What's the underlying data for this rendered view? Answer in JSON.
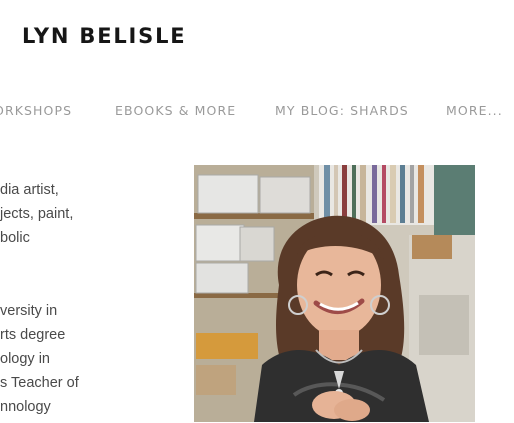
{
  "header": {
    "site_title": "LYN BELISLE"
  },
  "nav": {
    "items": [
      {
        "label": "ORKSHOPS"
      },
      {
        "label": "EBOOKS & MORE"
      },
      {
        "label": "MY BLOG: SHARDS"
      },
      {
        "label": "MORE..."
      }
    ]
  },
  "bio": {
    "lines": [
      "dia artist,",
      "jects, paint,",
      "bolic",
      "versity in",
      "rts degree",
      "ology in",
      "s Teacher of",
      "nnology"
    ]
  },
  "photo": {
    "subject": "portrait-woman-in-studio"
  }
}
